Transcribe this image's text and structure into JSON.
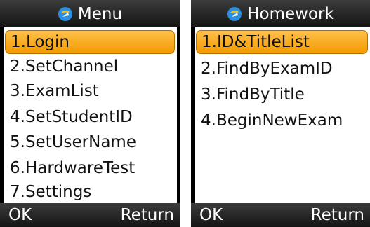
{
  "left_screen": {
    "title": "Menu",
    "title_icon": "app-logo-icon",
    "items": [
      {
        "label": "1.Login",
        "selected": true
      },
      {
        "label": "2.SetChannel"
      },
      {
        "label": "3.ExamList"
      },
      {
        "label": "4.SetStudentID"
      },
      {
        "label": "5.SetUserName"
      },
      {
        "label": "6.HardwareTest"
      },
      {
        "label": "7.Settings"
      }
    ],
    "softkey_left": "OK",
    "softkey_right": "Return"
  },
  "right_screen": {
    "title": "Homework",
    "title_icon": "app-logo-icon",
    "items": [
      {
        "label": "1.ID&TitleList",
        "selected": true
      },
      {
        "label": "2.FindByExamID"
      },
      {
        "label": "3.FindByTitle"
      },
      {
        "label": "4.BeginNewExam"
      }
    ],
    "softkey_left": "OK",
    "softkey_right": "Return"
  },
  "colors": {
    "highlight": "#f5a623",
    "bar_background": "#1e1e1e",
    "list_background": "#ffffff",
    "icon_blue": "#1e88e5"
  }
}
